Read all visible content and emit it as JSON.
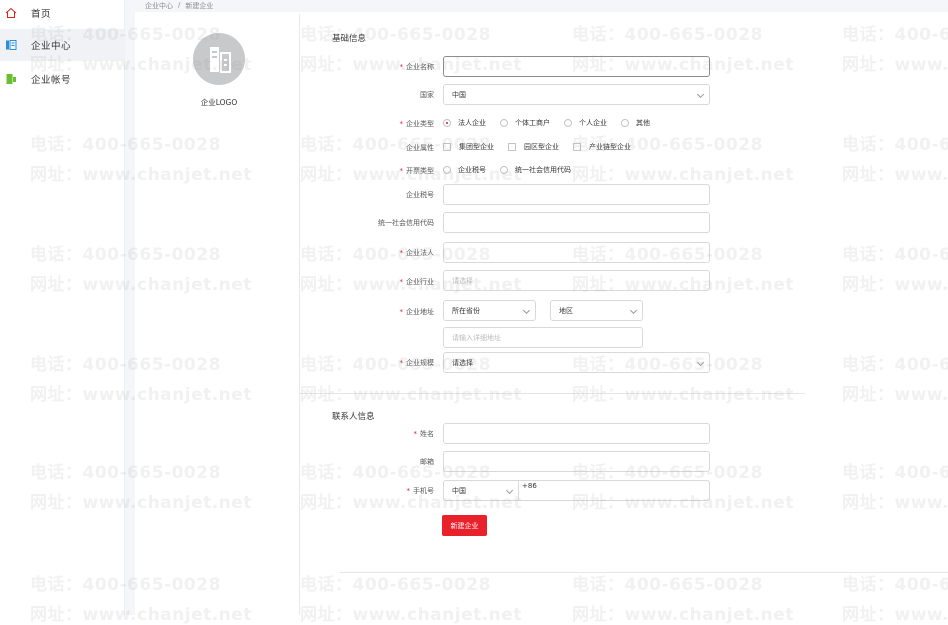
{
  "sidebar": {
    "items": [
      {
        "label": "首页",
        "icon": "home-icon"
      },
      {
        "label": "企业中心",
        "icon": "building-icon"
      },
      {
        "label": "企业帐号",
        "icon": "account-icon"
      }
    ]
  },
  "breadcrumb": {
    "parent": "企业中心",
    "sep": "/",
    "current": "新建企业"
  },
  "logo": {
    "label": "企业LOGO"
  },
  "sections": {
    "basic": "基础信息",
    "contact": "联系人信息"
  },
  "form": {
    "company_name": {
      "label": "企业名称",
      "value": ""
    },
    "country": {
      "label": "国家",
      "value": "中国"
    },
    "company_type": {
      "label": "企业类型",
      "options": [
        "法人企业",
        "个体工商户",
        "个人企业",
        "其他"
      ],
      "selected": 0
    },
    "company_attr": {
      "label": "企业属性",
      "options": [
        "集团型企业",
        "园区型企业",
        "产业链型企业"
      ]
    },
    "invoice_type": {
      "label": "开票类型",
      "options": [
        "企业税号",
        "统一社会信用代码"
      ],
      "selected": -1
    },
    "tax_number": {
      "label": "企业税号",
      "value": ""
    },
    "credit_code": {
      "label": "统一社会信用代码",
      "value": ""
    },
    "legal_person": {
      "label": "企业法人",
      "value": ""
    },
    "industry": {
      "label": "企业行业",
      "placeholder": "请选择"
    },
    "address": {
      "label": "企业地址",
      "province": "所在省份",
      "region": "地区",
      "detail_placeholder": "请输入详细地址"
    },
    "scale": {
      "label": "企业规模",
      "value": "请选择"
    },
    "contact_name": {
      "label": "姓名",
      "value": ""
    },
    "email": {
      "label": "邮箱",
      "value": ""
    },
    "phone": {
      "label": "手机号",
      "country": "中国",
      "prefix": "+86"
    }
  },
  "submit": {
    "label": "新建企业"
  },
  "watermark": {
    "phone": "电话：400-665-0028",
    "site": "网址：www.chanjet.net"
  },
  "colors": {
    "accent": "#e8212b",
    "sidebar_active": "#f0f2f5",
    "icon_blue": "#2a8fd6",
    "icon_green": "#6bbf2f",
    "icon_red": "#e02020"
  }
}
